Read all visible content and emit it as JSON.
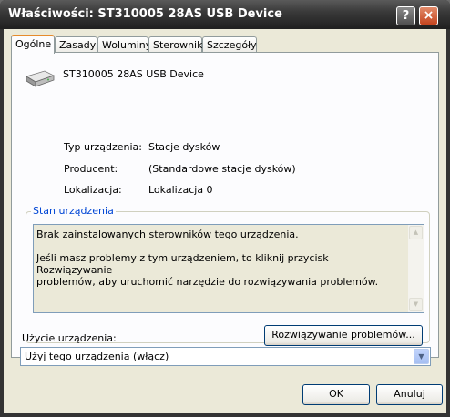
{
  "window": {
    "title": "Właściwości: ST310005 28AS USB Device",
    "help_glyph": "?",
    "close_glyph": "×"
  },
  "tabs": [
    {
      "label": "Ogólne",
      "active": true
    },
    {
      "label": "Zasady",
      "active": false
    },
    {
      "label": "Woluminy",
      "active": false
    },
    {
      "label": "Sterownik",
      "active": false
    },
    {
      "label": "Szczegóły",
      "active": false
    }
  ],
  "device": {
    "icon": "hard-drive-icon",
    "name": "ST310005 28AS USB Device"
  },
  "properties": [
    {
      "label": "Typ urządzenia:",
      "value": "Stacje dysków"
    },
    {
      "label": "Producent:",
      "value": "(Standardowe stacje dysków)"
    },
    {
      "label": "Lokalizacja:",
      "value": "Lokalizacja 0"
    }
  ],
  "status": {
    "group_label": "Stan urządzenia",
    "text": "Brak zainstalowanych sterowników tego urządzenia.\n\nJeśli masz problemy z tym urządzeniem, to kliknij przycisk Rozwiązywanie\nproblemów, aby uruchomić narzędzie do rozwiązywania problemów.",
    "troubleshoot_button": "Rozwiązywanie problemów..."
  },
  "usage": {
    "label": "Użycie urządzenia:",
    "selected": "Użyj tego urządzenia (włącz)"
  },
  "footer": {
    "ok": "OK",
    "cancel": "Anuluj"
  }
}
